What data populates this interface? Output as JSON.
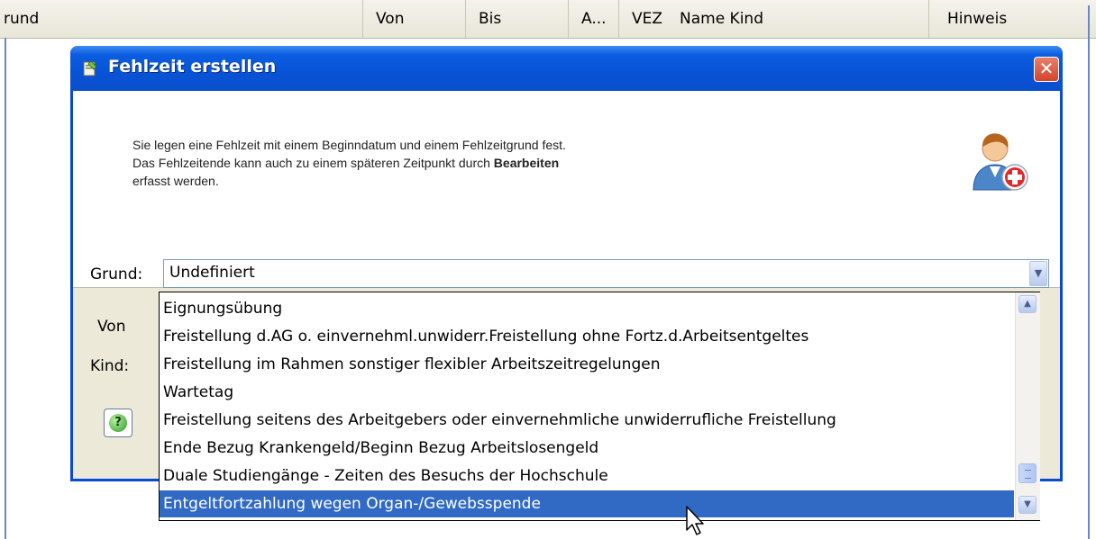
{
  "grid": {
    "columns": [
      "rund",
      "Von",
      "Bis",
      "A...",
      "VEZ",
      "Name Kind",
      "Hinweis"
    ]
  },
  "dialog": {
    "title": "Fehlzeit erstellen",
    "close_label": "✕",
    "info_line1": "Sie legen eine Fehlzeit mit einem Beginndatum und einem Fehlzeitgrund fest.",
    "info_line2_prefix": "Das Fehlzeitende kann auch zu einem späteren Zeitpunkt durch ",
    "info_line2_bold": "Bearbeiten",
    "info_line3": "erfasst werden.",
    "grund_label": "Grund:",
    "von_label": "Von",
    "kind_label": "Kind:",
    "grund_value": "Undefiniert",
    "help_label": "?"
  },
  "dropdown": {
    "items": [
      "Eignungsübung",
      "Freistellung d.AG o. einvernehml.unwiderr.Freistellung ohne Fortz.d.Arbeitsentgeltes",
      "Freistellung im Rahmen sonstiger flexibler Arbeitszeitregelungen",
      "Wartetag",
      "Freistellung seitens des Arbeitgebers oder einvernehmliche unwiderrufliche Freistellung",
      "Ende Bezug Krankengeld/Beginn Bezug Arbeitslosengeld",
      "Duale Studiengänge - Zeiten des Besuchs der Hochschule",
      "Entgeltfortzahlung wegen Organ-/Gewebsspende"
    ],
    "selected_index": 7
  },
  "colors": {
    "titlebar": "#0853d6",
    "selection": "#316ac5",
    "dialog_bg": "#ece9d8"
  },
  "icons": {
    "title": "document-edit-icon",
    "person": "user-add-icon",
    "help": "help-icon",
    "cursor": "mouse-pointer-icon"
  }
}
